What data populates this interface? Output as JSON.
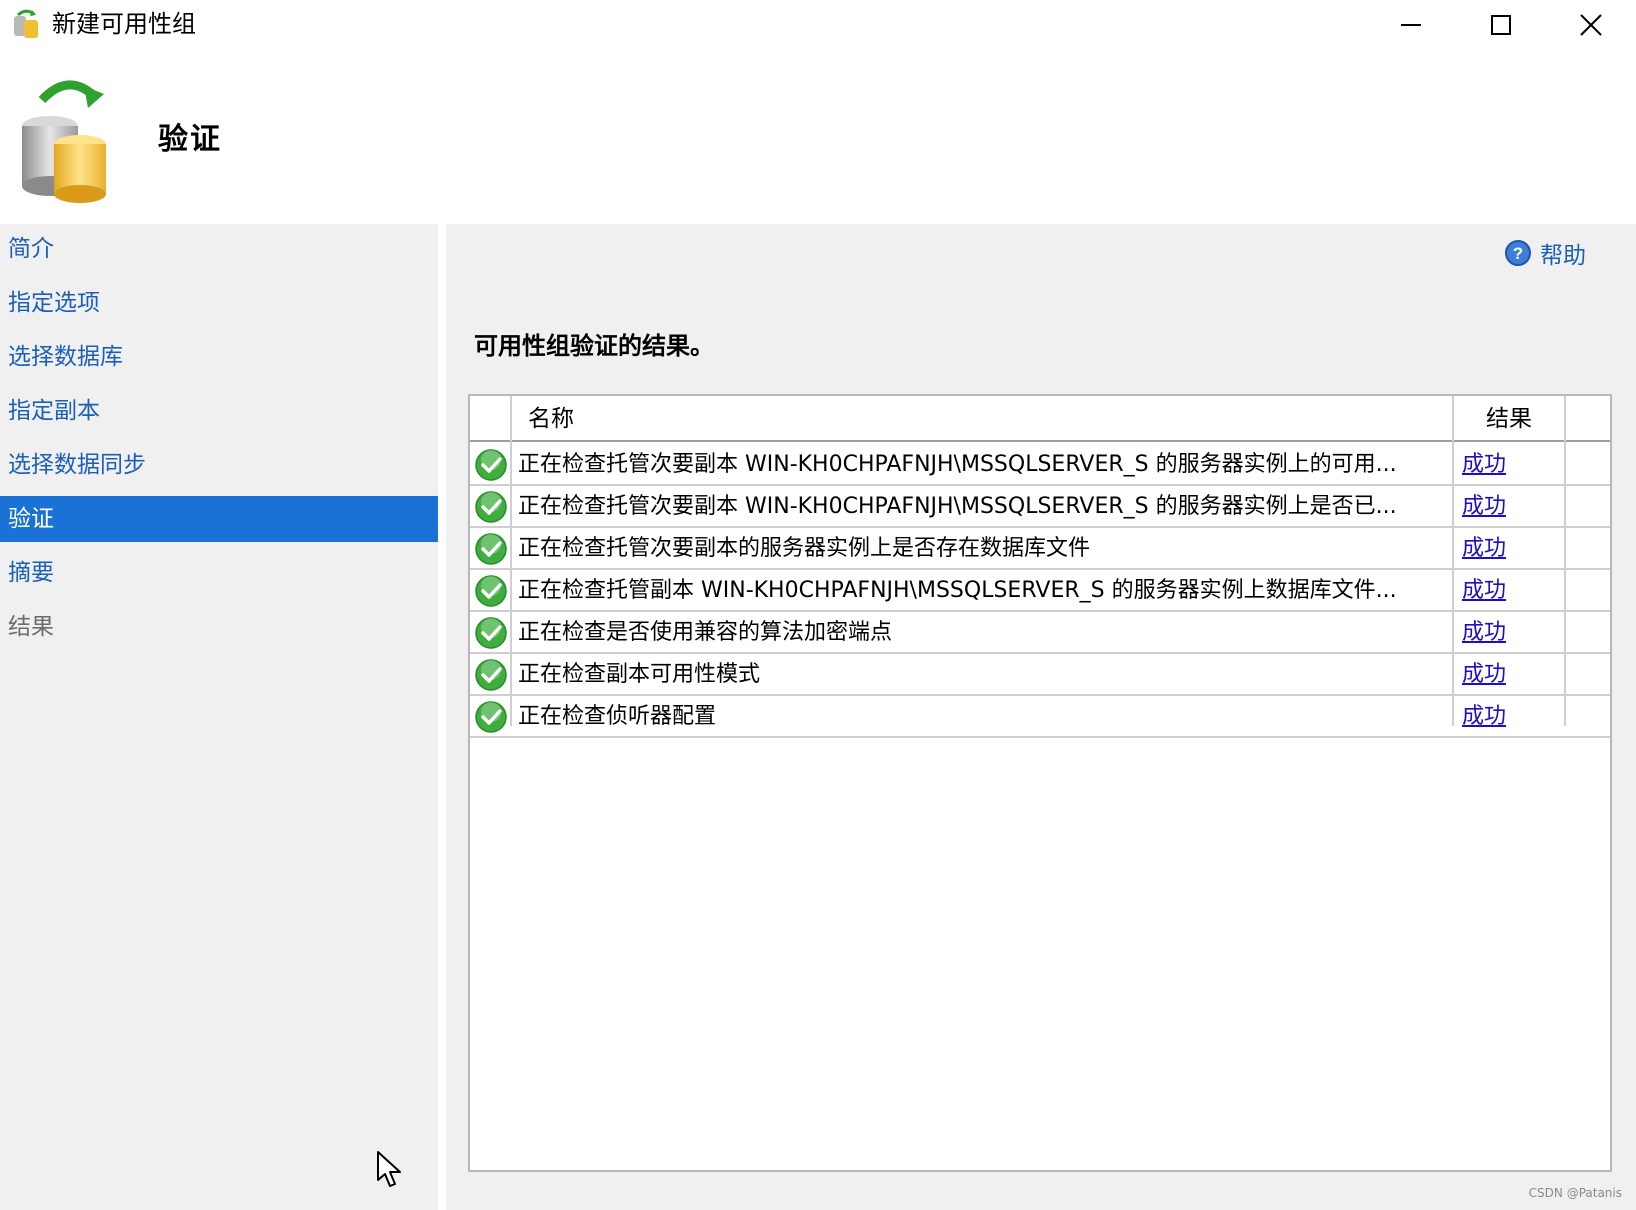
{
  "window": {
    "title": "新建可用性组",
    "icons": [
      "app-database-icon",
      "minimize-icon",
      "maximize-icon",
      "close-icon"
    ]
  },
  "header": {
    "heading": "验证",
    "icon": "database-sync-icon"
  },
  "nav": {
    "items": [
      {
        "label": "简介",
        "state": "link"
      },
      {
        "label": "指定选项",
        "state": "link"
      },
      {
        "label": "选择数据库",
        "state": "link"
      },
      {
        "label": "指定副本",
        "state": "link"
      },
      {
        "label": "选择数据同步",
        "state": "link"
      },
      {
        "label": "验证",
        "state": "selected"
      },
      {
        "label": "摘要",
        "state": "link"
      },
      {
        "label": "结果",
        "state": "disabled"
      }
    ]
  },
  "main": {
    "help_label": "帮助",
    "section_title": "可用性组验证的结果。",
    "grid": {
      "columns": [
        "名称",
        "结果"
      ],
      "rows": [
        {
          "status": "success-icon",
          "name": "正在检查托管次要副本 WIN-KH0CHPAFNJH\\MSSQLSERVER_S 的服务器实例上的可用...",
          "result": "成功"
        },
        {
          "status": "success-icon",
          "name": "正在检查托管次要副本 WIN-KH0CHPAFNJH\\MSSQLSERVER_S 的服务器实例上是否已...",
          "result": "成功"
        },
        {
          "status": "success-icon",
          "name": "正在检查托管次要副本的服务器实例上是否存在数据库文件",
          "result": "成功"
        },
        {
          "status": "success-icon",
          "name": "正在检查托管副本 WIN-KH0CHPAFNJH\\MSSQLSERVER_S 的服务器实例上数据库文件...",
          "result": "成功"
        },
        {
          "status": "success-icon",
          "name": "正在检查是否使用兼容的算法加密端点",
          "result": "成功"
        },
        {
          "status": "success-icon",
          "name": "正在检查副本可用性模式",
          "result": "成功"
        },
        {
          "status": "success-icon",
          "name": "正在检查侦听器配置",
          "result": "成功"
        }
      ]
    }
  },
  "colors": {
    "nav_link": "#1b5fb8",
    "nav_selected_bg": "#1b72d6",
    "result_link": "#1a0dcc",
    "success_green": "#3fae3f"
  },
  "watermark": "CSDN @Patanis"
}
